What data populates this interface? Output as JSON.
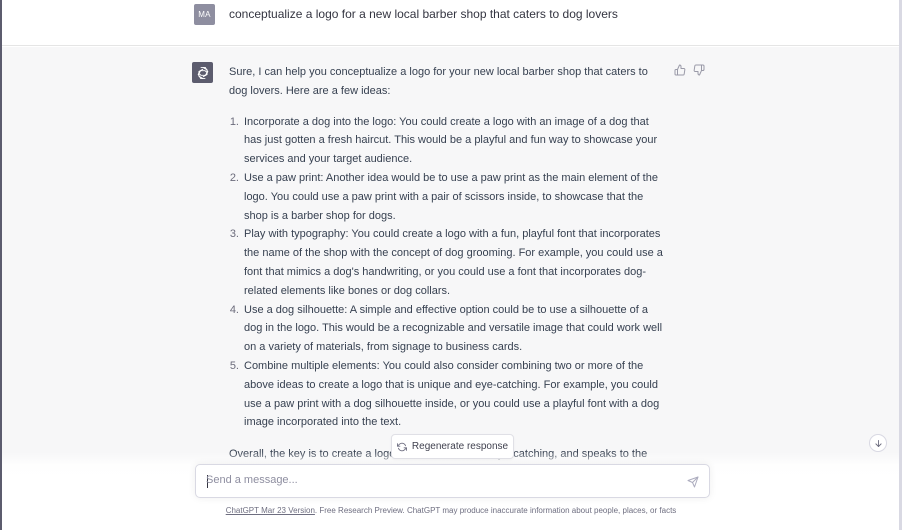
{
  "user_message": {
    "avatar_initials": "MA",
    "text": "conceptualize a logo for a new local barber shop that caters to dog lovers"
  },
  "assistant_message": {
    "avatar_icon": "openai-logo-icon",
    "intro": "Sure, I can help you conceptualize a logo for your new local barber shop that caters to dog lovers. Here are a few ideas:",
    "ideas": [
      {
        "number": "1.",
        "text": "Incorporate a dog into the logo: You could create a logo with an image of a dog that has just gotten a fresh haircut. This would be a playful and fun way to showcase your services and your target audience."
      },
      {
        "number": "2.",
        "text": "Use a paw print: Another idea would be to use a paw print as the main element of the logo. You could use a paw print with a pair of scissors inside, to showcase that the shop is a barber shop for dogs."
      },
      {
        "number": "3.",
        "text": "Play with typography: You could create a logo with a fun, playful font that incorporates the name of the shop with the concept of dog grooming. For example, you could use a font that mimics a dog's handwriting, or you could use a font that incorporates dog-related elements like bones or dog collars."
      },
      {
        "number": "4.",
        "text": "Use a dog silhouette: A simple and effective option could be to use a silhouette of a dog in the logo. This would be a recognizable and versatile image that could work well on a variety of materials, from signage to business cards."
      },
      {
        "number": "5.",
        "text": "Combine multiple elements: You could also consider combining two or more of the above ideas to create a logo that is unique and eye-catching. For example, you could use a paw print with a dog silhouette inside, or you could use a playful font with a dog image incorporated into the text."
      }
    ],
    "outro": "Overall, the key is to create a logo that is memorable, eye-catching, and speaks to the"
  },
  "feedback": {
    "thumbs_up_icon": "thumbs-up-icon",
    "thumbs_down_icon": "thumbs-down-icon"
  },
  "regenerate": {
    "label": "Regenerate response",
    "icon": "refresh-icon"
  },
  "composer": {
    "placeholder": "Send a message...",
    "send_icon": "send-icon"
  },
  "scroll_down_icon": "arrow-down-icon",
  "footer": {
    "link_text": "ChatGPT Mar 23 Version",
    "text": ". Free Research Preview. ChatGPT may produce inaccurate information about people, places, or facts"
  },
  "colors": {
    "assistant_bg": "#f7f7f8",
    "user_avatar": "#8e8ea0",
    "bot_avatar": "#5c5c6e",
    "text": "#374151"
  }
}
